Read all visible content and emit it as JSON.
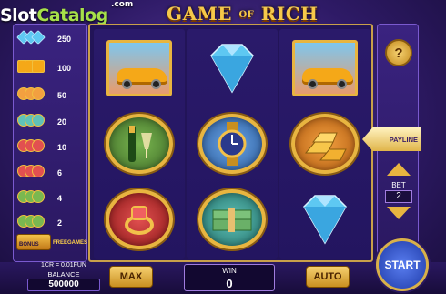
{
  "logo": {
    "slot": "Slot",
    "catalog": "Catalog",
    "domain": ".com"
  },
  "game": {
    "title_main": "GAME",
    "title_of": "OF",
    "title_end": "RICH"
  },
  "paytable": {
    "rows": [
      {
        "symbol": "diamond",
        "value": "250"
      },
      {
        "symbol": "car",
        "value": "100"
      },
      {
        "symbol": "gold-bars",
        "value": "50"
      },
      {
        "symbol": "cash",
        "value": "20"
      },
      {
        "symbol": "watch",
        "value": "10"
      },
      {
        "symbol": "ring",
        "value": "6"
      },
      {
        "symbol": "champagne",
        "value": "4"
      },
      {
        "symbol": "wild",
        "value": "2"
      }
    ],
    "freegames_label": "FREEGAMES",
    "bonus_label": "BONUS"
  },
  "reels": [
    [
      "car",
      "champagne",
      "ring"
    ],
    [
      "diamond",
      "watch",
      "cash"
    ],
    [
      "car",
      "gold-bars",
      "diamond"
    ]
  ],
  "controls": {
    "help_label": "?",
    "payline_label": "PAYLINE",
    "bet_label": "BET",
    "bet_value": "2",
    "credit_ratio": "1CR = 0.01FUN",
    "balance_label": "BALANCE",
    "balance_value": "500000",
    "max_label": "MAX",
    "win_label": "WIN",
    "win_value": "0",
    "auto_label": "AUTO",
    "start_label": "START"
  },
  "colors": {
    "accent_gold": "#e8b540",
    "bg_purple": "#2e1a66",
    "logo_green": "#a6e04a"
  }
}
